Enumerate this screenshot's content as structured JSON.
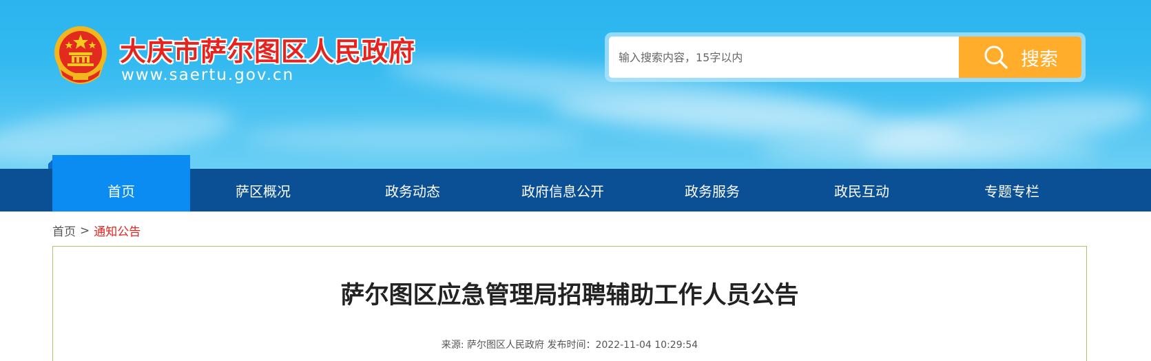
{
  "header": {
    "site_title": "大庆市萨尔图区人民政府",
    "site_url": "www.saertu.gov.cn",
    "emblem_icon": "national-emblem-icon"
  },
  "search": {
    "placeholder": "输入搜索内容，15字以内",
    "button_label": "搜索",
    "button_icon": "search-icon"
  },
  "nav": {
    "items": [
      {
        "label": "首页",
        "active": true
      },
      {
        "label": "萨区概况"
      },
      {
        "label": "政务动态"
      },
      {
        "label": "政府信息公开"
      },
      {
        "label": "政务服务"
      },
      {
        "label": "政民互动"
      },
      {
        "label": "专题专栏"
      }
    ]
  },
  "breadcrumb": {
    "home": "首页",
    "separator": ">",
    "current": "通知公告"
  },
  "article": {
    "title": "萨尔图区应急管理局招聘辅助工作人员公告",
    "meta": "来源: 萨尔图区人民政府 发布时间：2022-11-04 10:29:54"
  },
  "colors": {
    "nav_bg": "#0b5094",
    "nav_active": "#0a8cf3",
    "search_button": "#ffad2a",
    "title_red": "#e6241f",
    "article_border": "#a8c66c"
  }
}
